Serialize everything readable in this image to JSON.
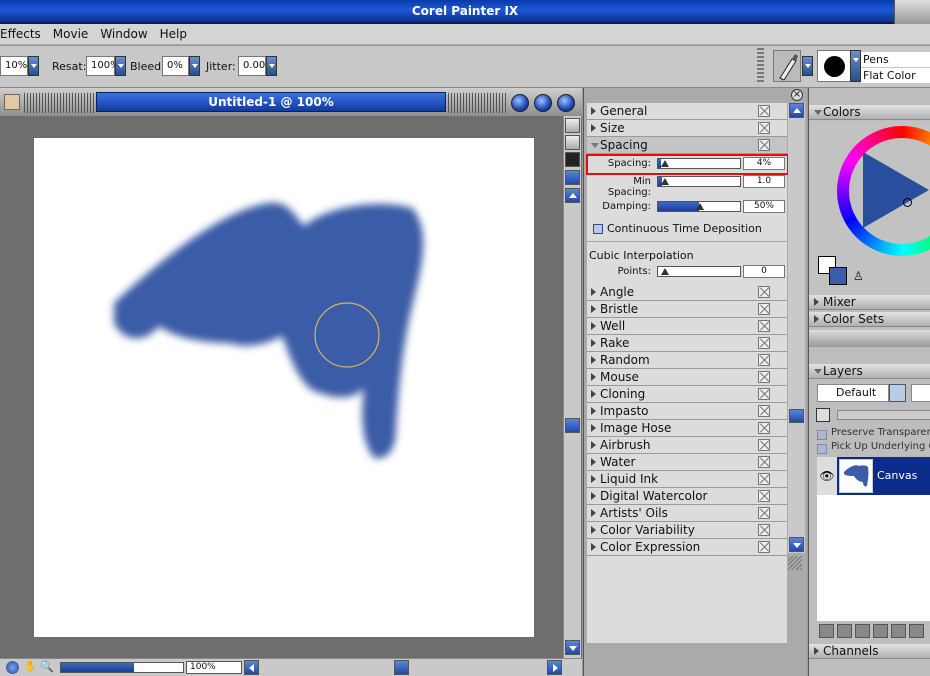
{
  "app": {
    "title": "Corel Painter IX"
  },
  "menu": {
    "items": [
      "Effects",
      "Movie",
      "Window",
      "Help"
    ]
  },
  "propbar": {
    "opacity_value": "10%",
    "resat_label": "Resat:",
    "resat_value": "100%",
    "bleed_label": "Bleed:",
    "bleed_value": "0%",
    "jitter_label": "Jitter:",
    "jitter_value": "0.00",
    "brush_category": "Pens",
    "brush_variant": "Flat Color"
  },
  "document": {
    "title": "Untitled-1 @ 100%",
    "zoom": "100%",
    "zoom_fraction": 0.6
  },
  "brush_controls": {
    "sections_top": [
      "General",
      "Size",
      "Spacing"
    ],
    "spacing": {
      "spacing_label": "Spacing:",
      "spacing_value": "4%",
      "spacing_fraction": 0.04,
      "min_spacing_label": "Min Spacing:",
      "min_spacing_value": "1.0",
      "min_spacing_fraction": 0.05,
      "damping_label": "Damping:",
      "damping_value": "50%",
      "damping_fraction": 0.5,
      "continuous_label": "Continuous Time Deposition",
      "cubic_label": "Cubic Interpolation",
      "points_label": "Points:",
      "points_value": "0",
      "points_fraction": 0
    },
    "sections_bottom": [
      "Angle",
      "Bristle",
      "Well",
      "Rake",
      "Random",
      "Mouse",
      "Cloning",
      "Impasto",
      "Image Hose",
      "Airbrush",
      "Water",
      "Liquid Ink",
      "Digital Watercolor",
      "Artists' Oils",
      "Color Variability",
      "Color Expression"
    ]
  },
  "colors_panel": {
    "title": "Colors",
    "mixer": "Mixer",
    "color_sets": "Color Sets"
  },
  "layers_panel": {
    "title": "Layers",
    "composite": "Default",
    "preserve": "Preserve Transparency",
    "pickup": "Pick Up Underlying Color",
    "layer_name": "Canvas",
    "channels": "Channels"
  },
  "colors": {
    "accent": "#3b5ca6",
    "highlight": "#e01010"
  }
}
